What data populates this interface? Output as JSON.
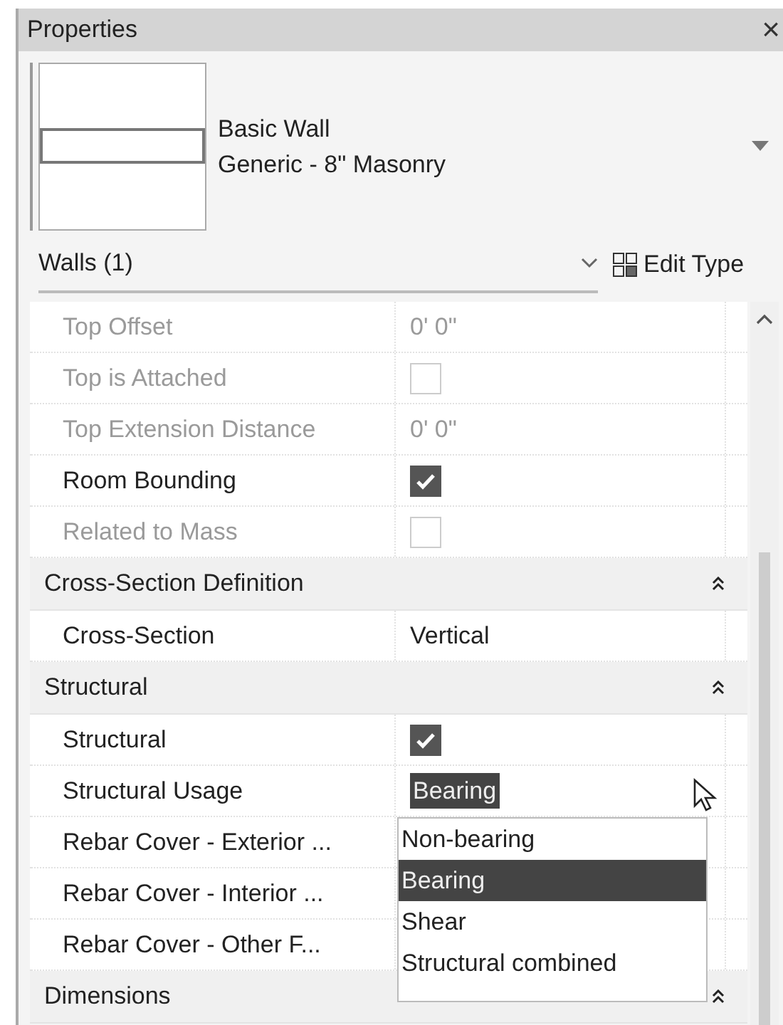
{
  "panel": {
    "title": "Properties",
    "close": "×"
  },
  "type_selector": {
    "family": "Basic Wall",
    "type": "Generic - 8\" Masonry"
  },
  "filter": {
    "label": "Walls (1)",
    "edit_type": "Edit Type"
  },
  "rows": [
    {
      "kind": "text",
      "label": "Top Offset",
      "value": "0'  0\"",
      "disabled": true
    },
    {
      "kind": "checkbox",
      "label": "Top is Attached",
      "checked": false,
      "disabled": true
    },
    {
      "kind": "text",
      "label": "Top Extension Distance",
      "value": "0'  0\"",
      "disabled": true
    },
    {
      "kind": "checkbox",
      "label": "Room Bounding",
      "checked": true,
      "disabled": false
    },
    {
      "kind": "checkbox",
      "label": "Related to Mass",
      "checked": false,
      "disabled": true
    },
    {
      "kind": "header",
      "label": "Cross-Section Definition",
      "expanded": true
    },
    {
      "kind": "text",
      "label": "Cross-Section",
      "value": "Vertical",
      "disabled": false
    },
    {
      "kind": "header",
      "label": "Structural",
      "expanded": true
    },
    {
      "kind": "checkbox",
      "label": "Structural",
      "checked": true,
      "disabled": false
    },
    {
      "kind": "select",
      "label": "Structural Usage",
      "value": "Bearing",
      "disabled": false,
      "options": [
        {
          "label": "Non-bearing",
          "selected": false
        },
        {
          "label": "Bearing",
          "selected": true
        },
        {
          "label": "Shear",
          "selected": false
        },
        {
          "label": "Structural combined",
          "selected": false
        }
      ]
    },
    {
      "kind": "text",
      "label": "Rebar Cover - Exterior ...",
      "disabled": false
    },
    {
      "kind": "text",
      "label": "Rebar Cover - Interior ...",
      "disabled": false
    },
    {
      "kind": "text",
      "label": "Rebar Cover - Other F...",
      "disabled": false
    },
    {
      "kind": "header",
      "label": "Dimensions",
      "expanded": true
    }
  ]
}
